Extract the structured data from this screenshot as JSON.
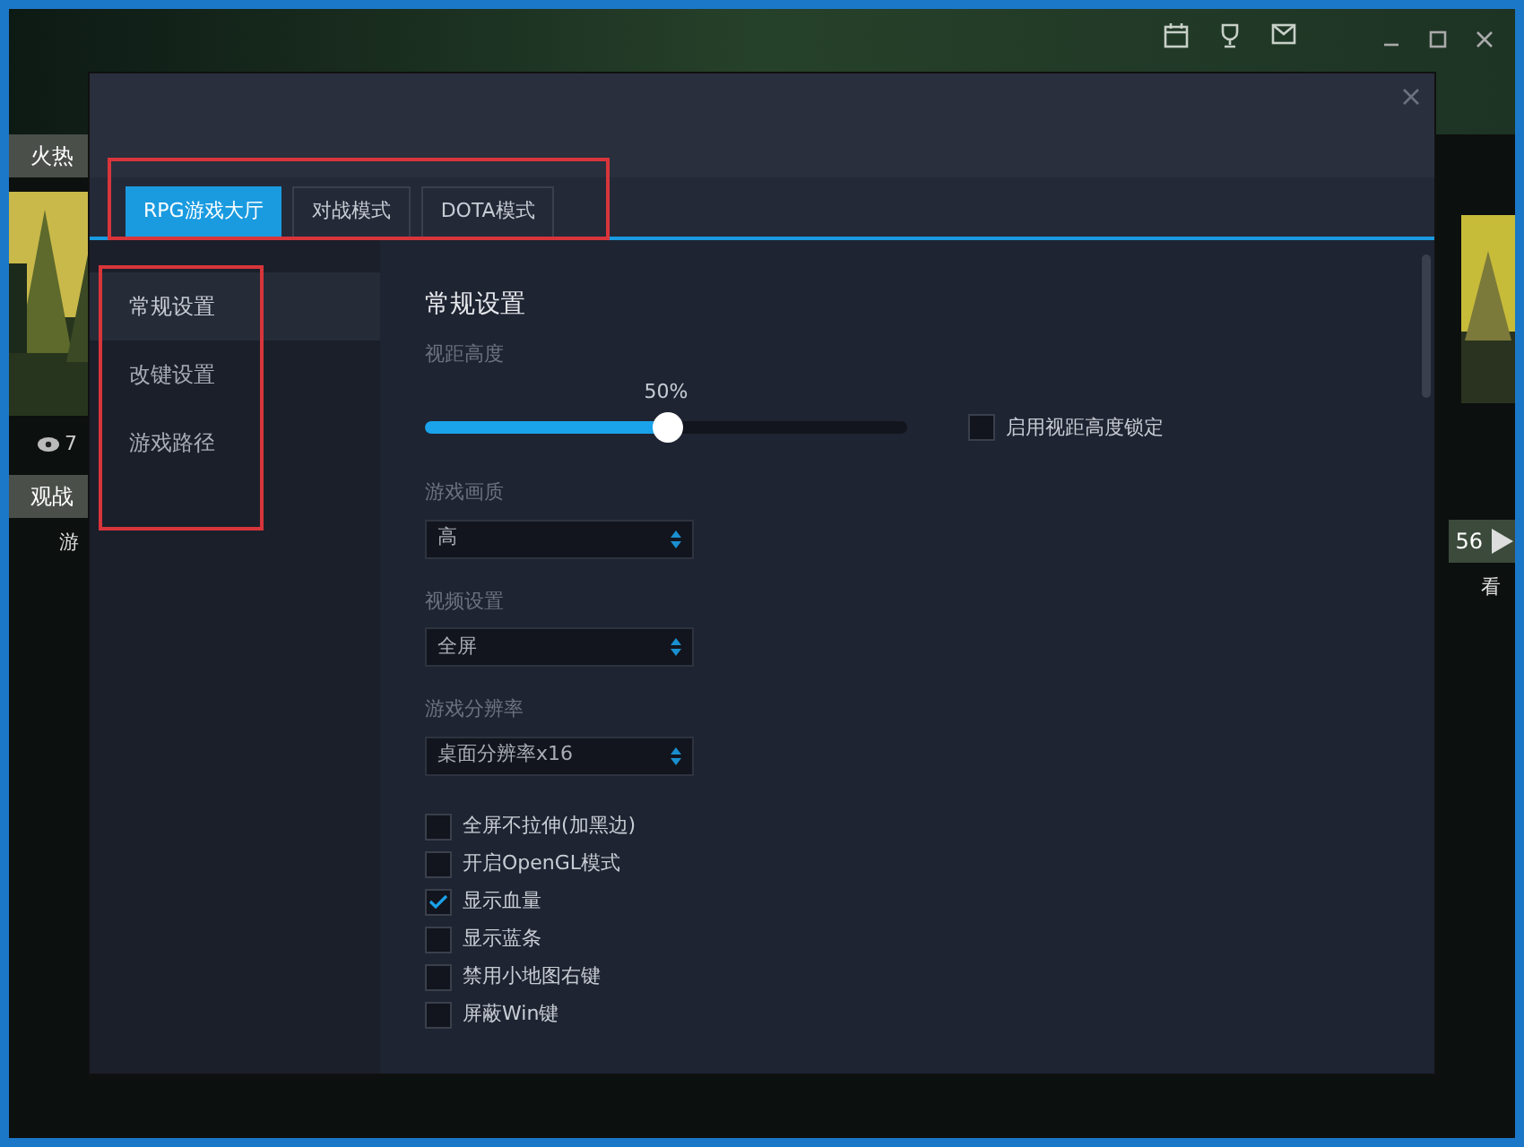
{
  "app": {
    "left_tab": "火热",
    "view_count": "7",
    "left_tab_2": "观战",
    "left_row": "游",
    "right_count": "56",
    "right_row": "看"
  },
  "dialog": {
    "tabs": [
      {
        "label": "RPG游戏大厅",
        "selected": true
      },
      {
        "label": "对战模式",
        "selected": false
      },
      {
        "label": "DOTA模式",
        "selected": false
      }
    ],
    "sidebar": [
      {
        "label": "常规设置",
        "selected": true
      },
      {
        "label": "改键设置",
        "selected": false
      },
      {
        "label": "游戏路径",
        "selected": false
      }
    ],
    "section_title": "常规设置",
    "slider": {
      "label": "视距高度",
      "reading": "50%",
      "level": 0.5
    },
    "lock_checkbox": {
      "label": "启用视距高度锁定",
      "checked": false
    },
    "selects": [
      {
        "label": "游戏画质",
        "value": "高"
      },
      {
        "label": "视频设置",
        "value": "全屏"
      },
      {
        "label": "游戏分辨率",
        "value": "桌面分辨率x16"
      }
    ],
    "options": [
      {
        "label": "全屏不拉伸(加黑边)",
        "checked": false
      },
      {
        "label": "开启OpenGL模式",
        "checked": false
      },
      {
        "label": "显示血量",
        "checked": true
      },
      {
        "label": "显示蓝条",
        "checked": false
      },
      {
        "label": "禁用小地图右键",
        "checked": false
      },
      {
        "label": "屏蔽Win键",
        "checked": false
      }
    ]
  }
}
